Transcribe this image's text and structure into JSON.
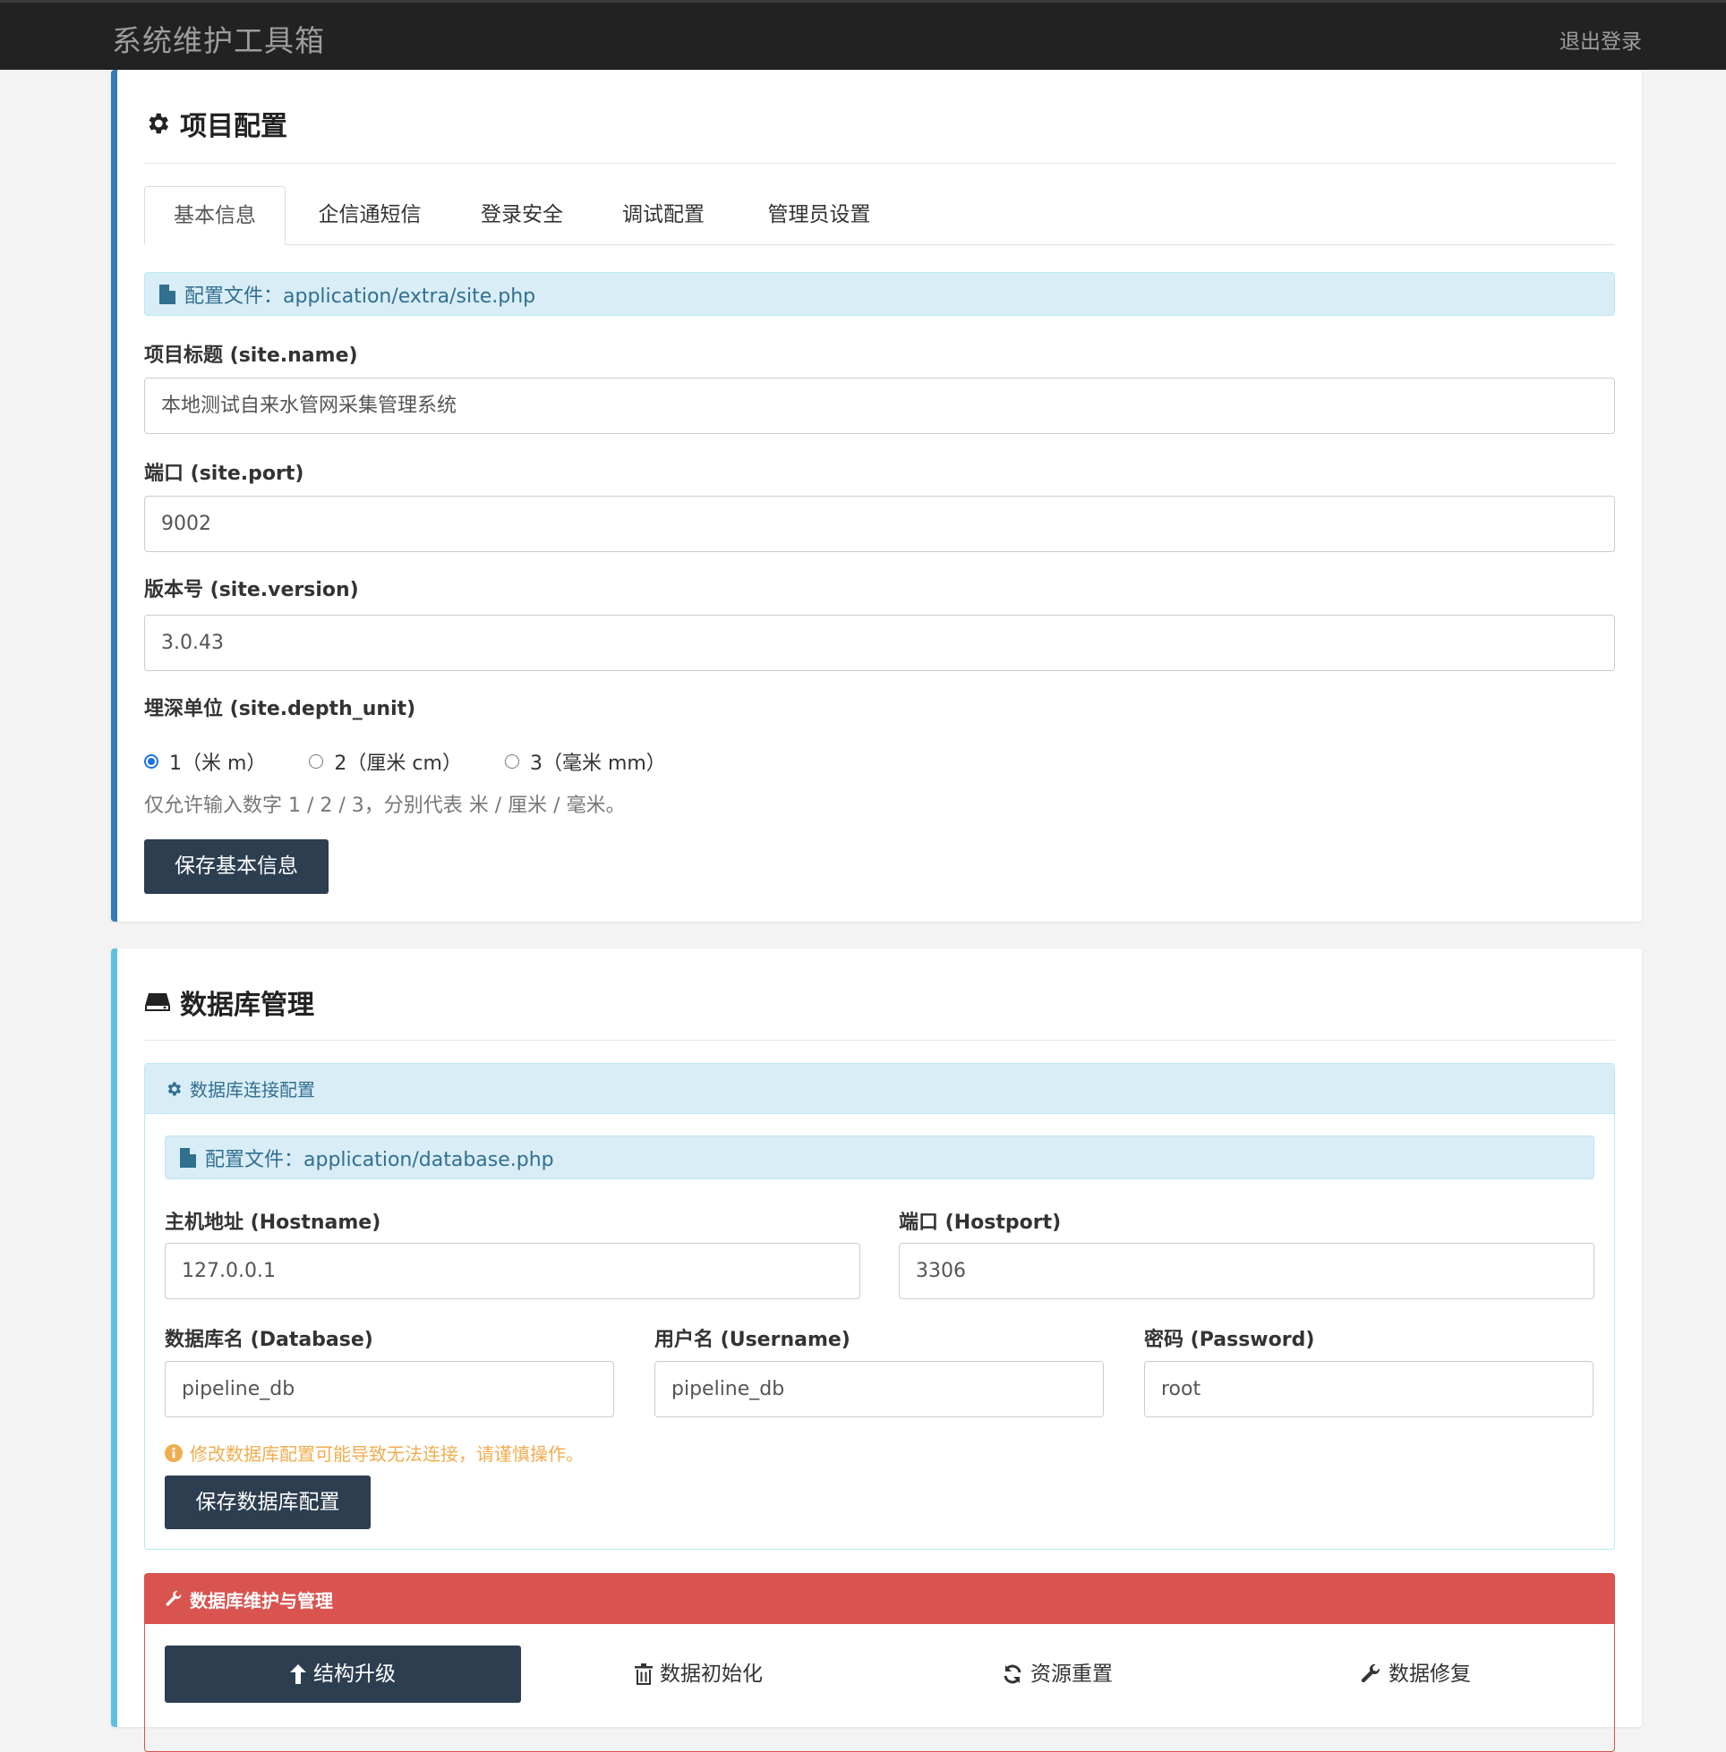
{
  "navbar": {
    "brand": "系统维护工具箱",
    "logout": "退出登录"
  },
  "project": {
    "title": "项目配置",
    "tabs": [
      {
        "label": "基本信息",
        "active": true
      },
      {
        "label": "企信通短信"
      },
      {
        "label": "登录安全"
      },
      {
        "label": "调试配置"
      },
      {
        "label": "管理员设置"
      }
    ],
    "config_file": "配置文件：application/extra/site.php",
    "fields": {
      "name_label": "项目标题 (site.name)",
      "name_value": "本地测试自来水管网采集管理系统",
      "port_label": "端口 (site.port)",
      "port_value": "9002",
      "version_label": "版本号 (site.version)",
      "version_value": "3.0.43",
      "depth_label": "埋深单位 (site.depth_unit)"
    },
    "depth_options": [
      {
        "label": "1（米 m）",
        "checked": true
      },
      {
        "label": "2（厘米 cm）",
        "checked": false
      },
      {
        "label": "3（毫米 mm）",
        "checked": false
      }
    ],
    "depth_help": "仅允许输入数字 1 / 2 / 3，分别代表 米 / 厘米 / 毫米。",
    "save_button": "保存基本信息"
  },
  "database": {
    "title": "数据库管理",
    "connection": {
      "heading": "数据库连接配置",
      "config_file": "配置文件：application/database.php",
      "hostname_label": "主机地址 (Hostname)",
      "hostname_value": "127.0.0.1",
      "hostport_label": "端口 (Hostport)",
      "hostport_value": "3306",
      "database_label": "数据库名 (Database)",
      "database_value": "pipeline_db",
      "username_label": "用户名 (Username)",
      "username_value": "pipeline_db",
      "password_label": "密码 (Password)",
      "password_value": "root",
      "warning": "修改数据库配置可能导致无法连接，请谨慎操作。",
      "save_button": "保存数据库配置"
    },
    "maintenance": {
      "heading": "数据库维护与管理",
      "actions": {
        "upgrade": "结构升级",
        "init": "数据初始化",
        "reset": "资源重置",
        "repair": "数据修复"
      }
    }
  },
  "colors": {
    "primary_border": "#337ab7",
    "info_border": "#5bc0de",
    "dark_button": "#2c3e50",
    "danger": "#d9534f",
    "warning": "#f0ad4e",
    "info_bg": "#d9edf7"
  }
}
